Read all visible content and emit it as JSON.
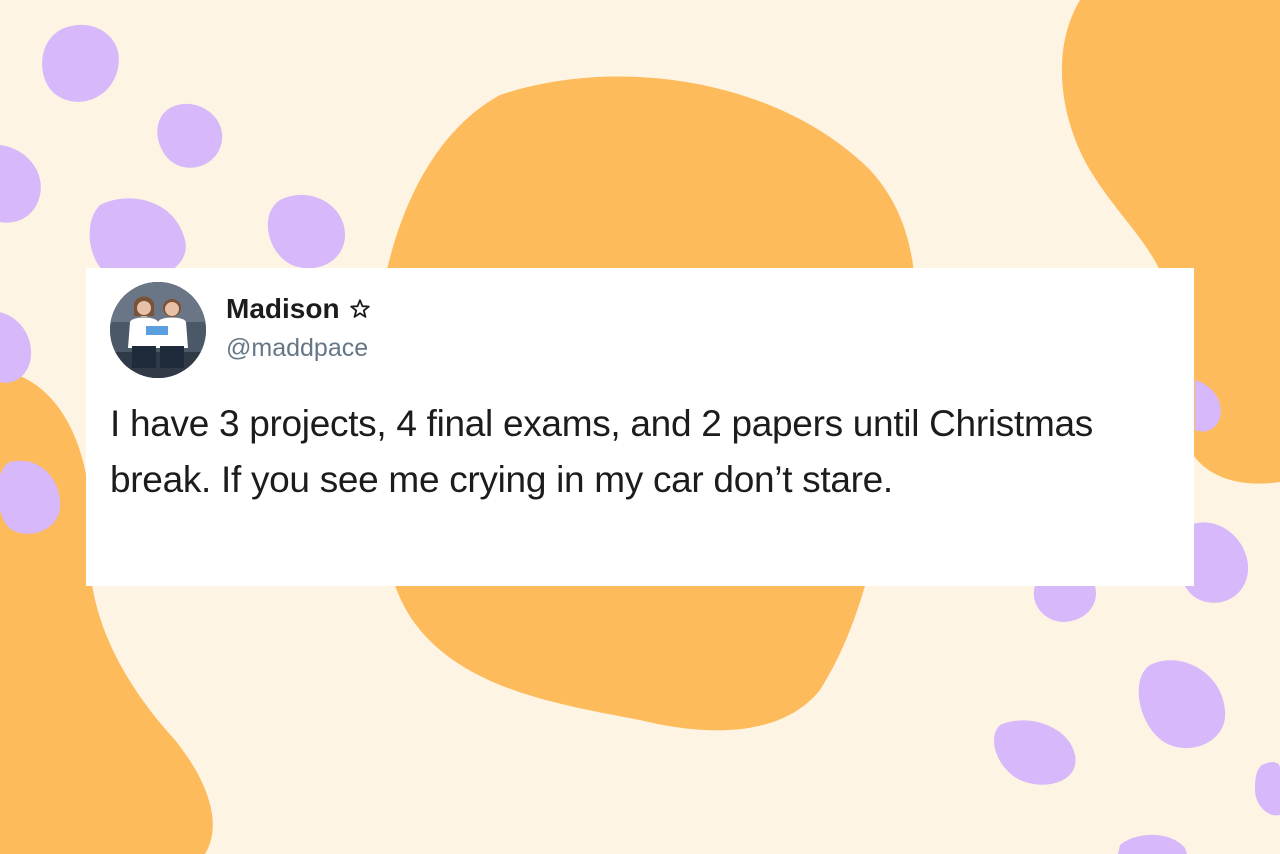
{
  "tweet": {
    "user": {
      "name": "Madison",
      "handle": "@maddpace",
      "avatar_icon": "profile-photo-two-people",
      "name_badge_icon": "outline-star-icon"
    },
    "text": "I have 3 projects, 4 final exams, and 2 papers until Christmas break. If you see me crying in my car don’t stare."
  },
  "colors": {
    "background": "#fdf4e3",
    "orange_blob": "#fdbb5c",
    "purple_dot": "#d6b8fb",
    "card": "#ffffff",
    "text": "#1c1c1c",
    "handle": "#657786"
  }
}
